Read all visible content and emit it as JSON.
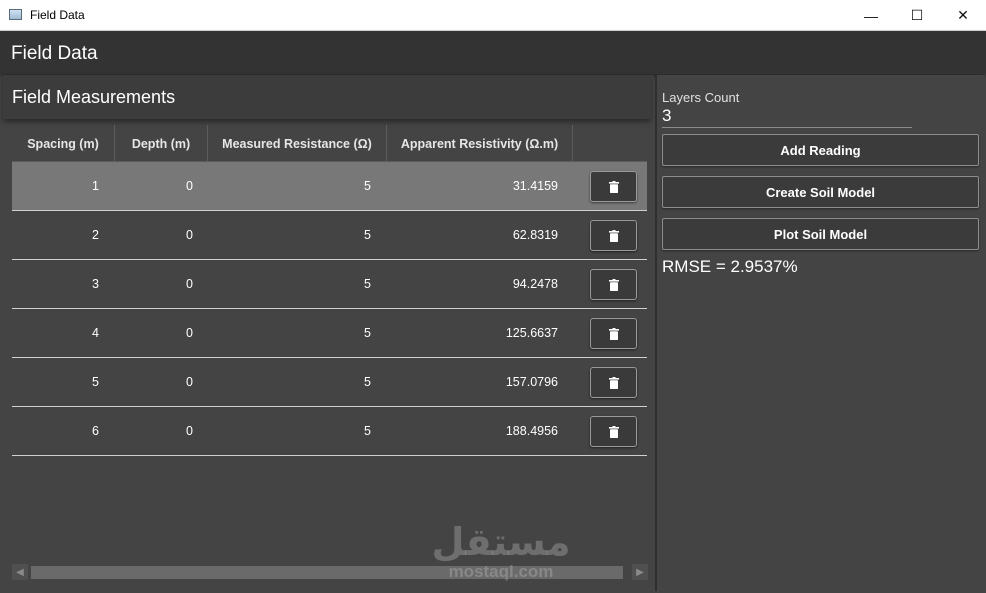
{
  "window": {
    "title": "Field Data",
    "controls": {
      "minimize": "—",
      "maximize": "☐",
      "close": "✕"
    }
  },
  "appbar": {
    "title": "Field Data"
  },
  "measurements": {
    "title": "Field Measurements",
    "columns": [
      "Spacing (m)",
      "Depth (m)",
      "Measured Resistance (Ω)",
      "Apparent Resistivity (Ω.m)"
    ],
    "rows": [
      {
        "spacing": "1",
        "depth": "0",
        "resistance": "5",
        "resistivity": "31.4159"
      },
      {
        "spacing": "2",
        "depth": "0",
        "resistance": "5",
        "resistivity": "62.8319"
      },
      {
        "spacing": "3",
        "depth": "0",
        "resistance": "5",
        "resistivity": "94.2478"
      },
      {
        "spacing": "4",
        "depth": "0",
        "resistance": "5",
        "resistivity": "125.6637"
      },
      {
        "spacing": "5",
        "depth": "0",
        "resistance": "5",
        "resistivity": "157.0796"
      },
      {
        "spacing": "6",
        "depth": "0",
        "resistance": "5",
        "resistivity": "188.4956"
      }
    ],
    "selected_row": 0,
    "delete_icon": "trash-icon"
  },
  "scrollbar": {
    "left_arrow": "◀",
    "right_arrow": "▶"
  },
  "watermark": {
    "arabic": "مستقل",
    "latin": "mostaql.com"
  },
  "sidebar": {
    "layers_label": "Layers Count",
    "layers_value": "3",
    "add_reading": "Add Reading",
    "create_model": "Create Soil Model",
    "plot_model": "Plot Soil Model",
    "rmse": "RMSE = 2.9537%"
  },
  "colors": {
    "background": "#444444",
    "appbar": "#333333",
    "selected_row": "#787878",
    "text": "#ffffff"
  }
}
